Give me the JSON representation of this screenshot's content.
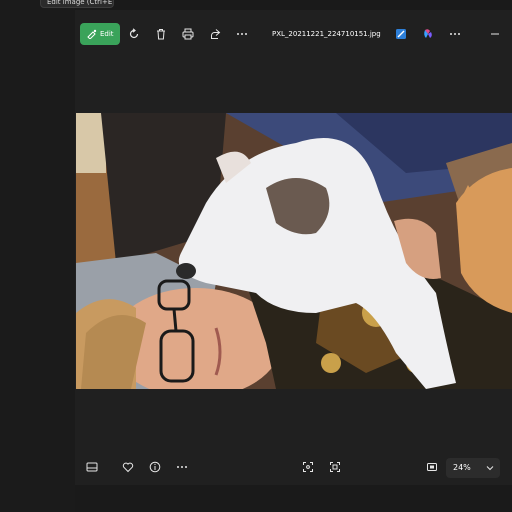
{
  "tooltip": {
    "text": "Edit image (Ctrl+E)"
  },
  "toolbar": {
    "edit_label": "Edit",
    "filename": "PXL_20211221_224710151.jpg"
  },
  "bottombar": {
    "zoom_value": "24%"
  },
  "colors": {
    "accent_green": "#3aa35a",
    "background": "#202020"
  },
  "icons": {
    "edit": "edit-icon",
    "rotate": "rotate-icon",
    "delete": "trash-icon",
    "print": "print-icon",
    "share": "share-icon",
    "more": "more-icon",
    "clipchamp": "clipchamp-icon",
    "copilot": "copilot-icon",
    "filmstrip": "filmstrip-icon",
    "favorite": "heart-icon",
    "info": "info-icon",
    "fullscreen": "fullscreen-icon",
    "actual_size": "actual-size-icon",
    "fit": "fit-to-window-icon",
    "chevron": "chevron-down-icon",
    "minimize": "minimize-icon"
  }
}
